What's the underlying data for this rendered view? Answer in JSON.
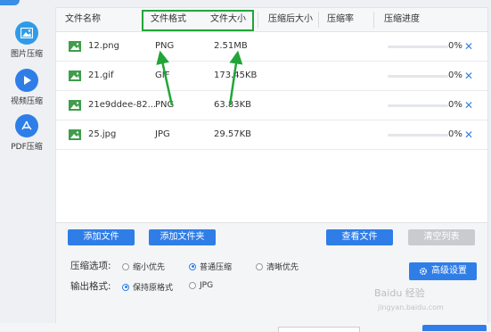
{
  "sidebar": {
    "items": [
      {
        "label": "图片压缩",
        "icon": "image-icon"
      },
      {
        "label": "视频压缩",
        "icon": "play-icon"
      },
      {
        "label": "PDF压缩",
        "icon": "pdf-icon"
      }
    ]
  },
  "table": {
    "columns": [
      "文件名称",
      "文件格式",
      "文件大小",
      "压缩后大小",
      "压缩率",
      "压缩进度"
    ],
    "rows": [
      {
        "name": "12.png",
        "format": "PNG",
        "size": "2.51MB",
        "compressed_size": "",
        "ratio": "",
        "progress": 0,
        "progress_label": "0%"
      },
      {
        "name": "21.gif",
        "format": "GIF",
        "size": "173.45KB",
        "compressed_size": "",
        "ratio": "",
        "progress": 0,
        "progress_label": "0%"
      },
      {
        "name": "21e9ddee-82...",
        "format": "PNG",
        "size": "63.83KB",
        "compressed_size": "",
        "ratio": "",
        "progress": 0,
        "progress_label": "0%"
      },
      {
        "name": "25.jpg",
        "format": "JPG",
        "size": "29.57KB",
        "compressed_size": "",
        "ratio": "",
        "progress": 0,
        "progress_label": "0%"
      }
    ],
    "remove_glyph": "✕"
  },
  "toolbar": {
    "add_file": "添加文件",
    "add_folder": "添加文件夹",
    "view_file": "查看文件",
    "clear_list": "清空列表"
  },
  "options": {
    "compression_label": "压缩选项:",
    "compression_choices": [
      "缩小优先",
      "普通压缩",
      "清晰优先"
    ],
    "compression_selected": "普通压缩",
    "output_label": "输出格式:",
    "output_choices": [
      "保持原格式",
      "JPG"
    ],
    "output_selected": "保持原格式",
    "advanced_settings": "高级设置"
  },
  "watermark": {
    "text": "Baidu 经验",
    "url": "jingyan.baidu.com"
  },
  "colors": {
    "accent": "#2f7ee8",
    "highlight_box": "#22a538",
    "annotation_arrow": "#22a538",
    "image_file_icon": "#3f9d4b"
  }
}
